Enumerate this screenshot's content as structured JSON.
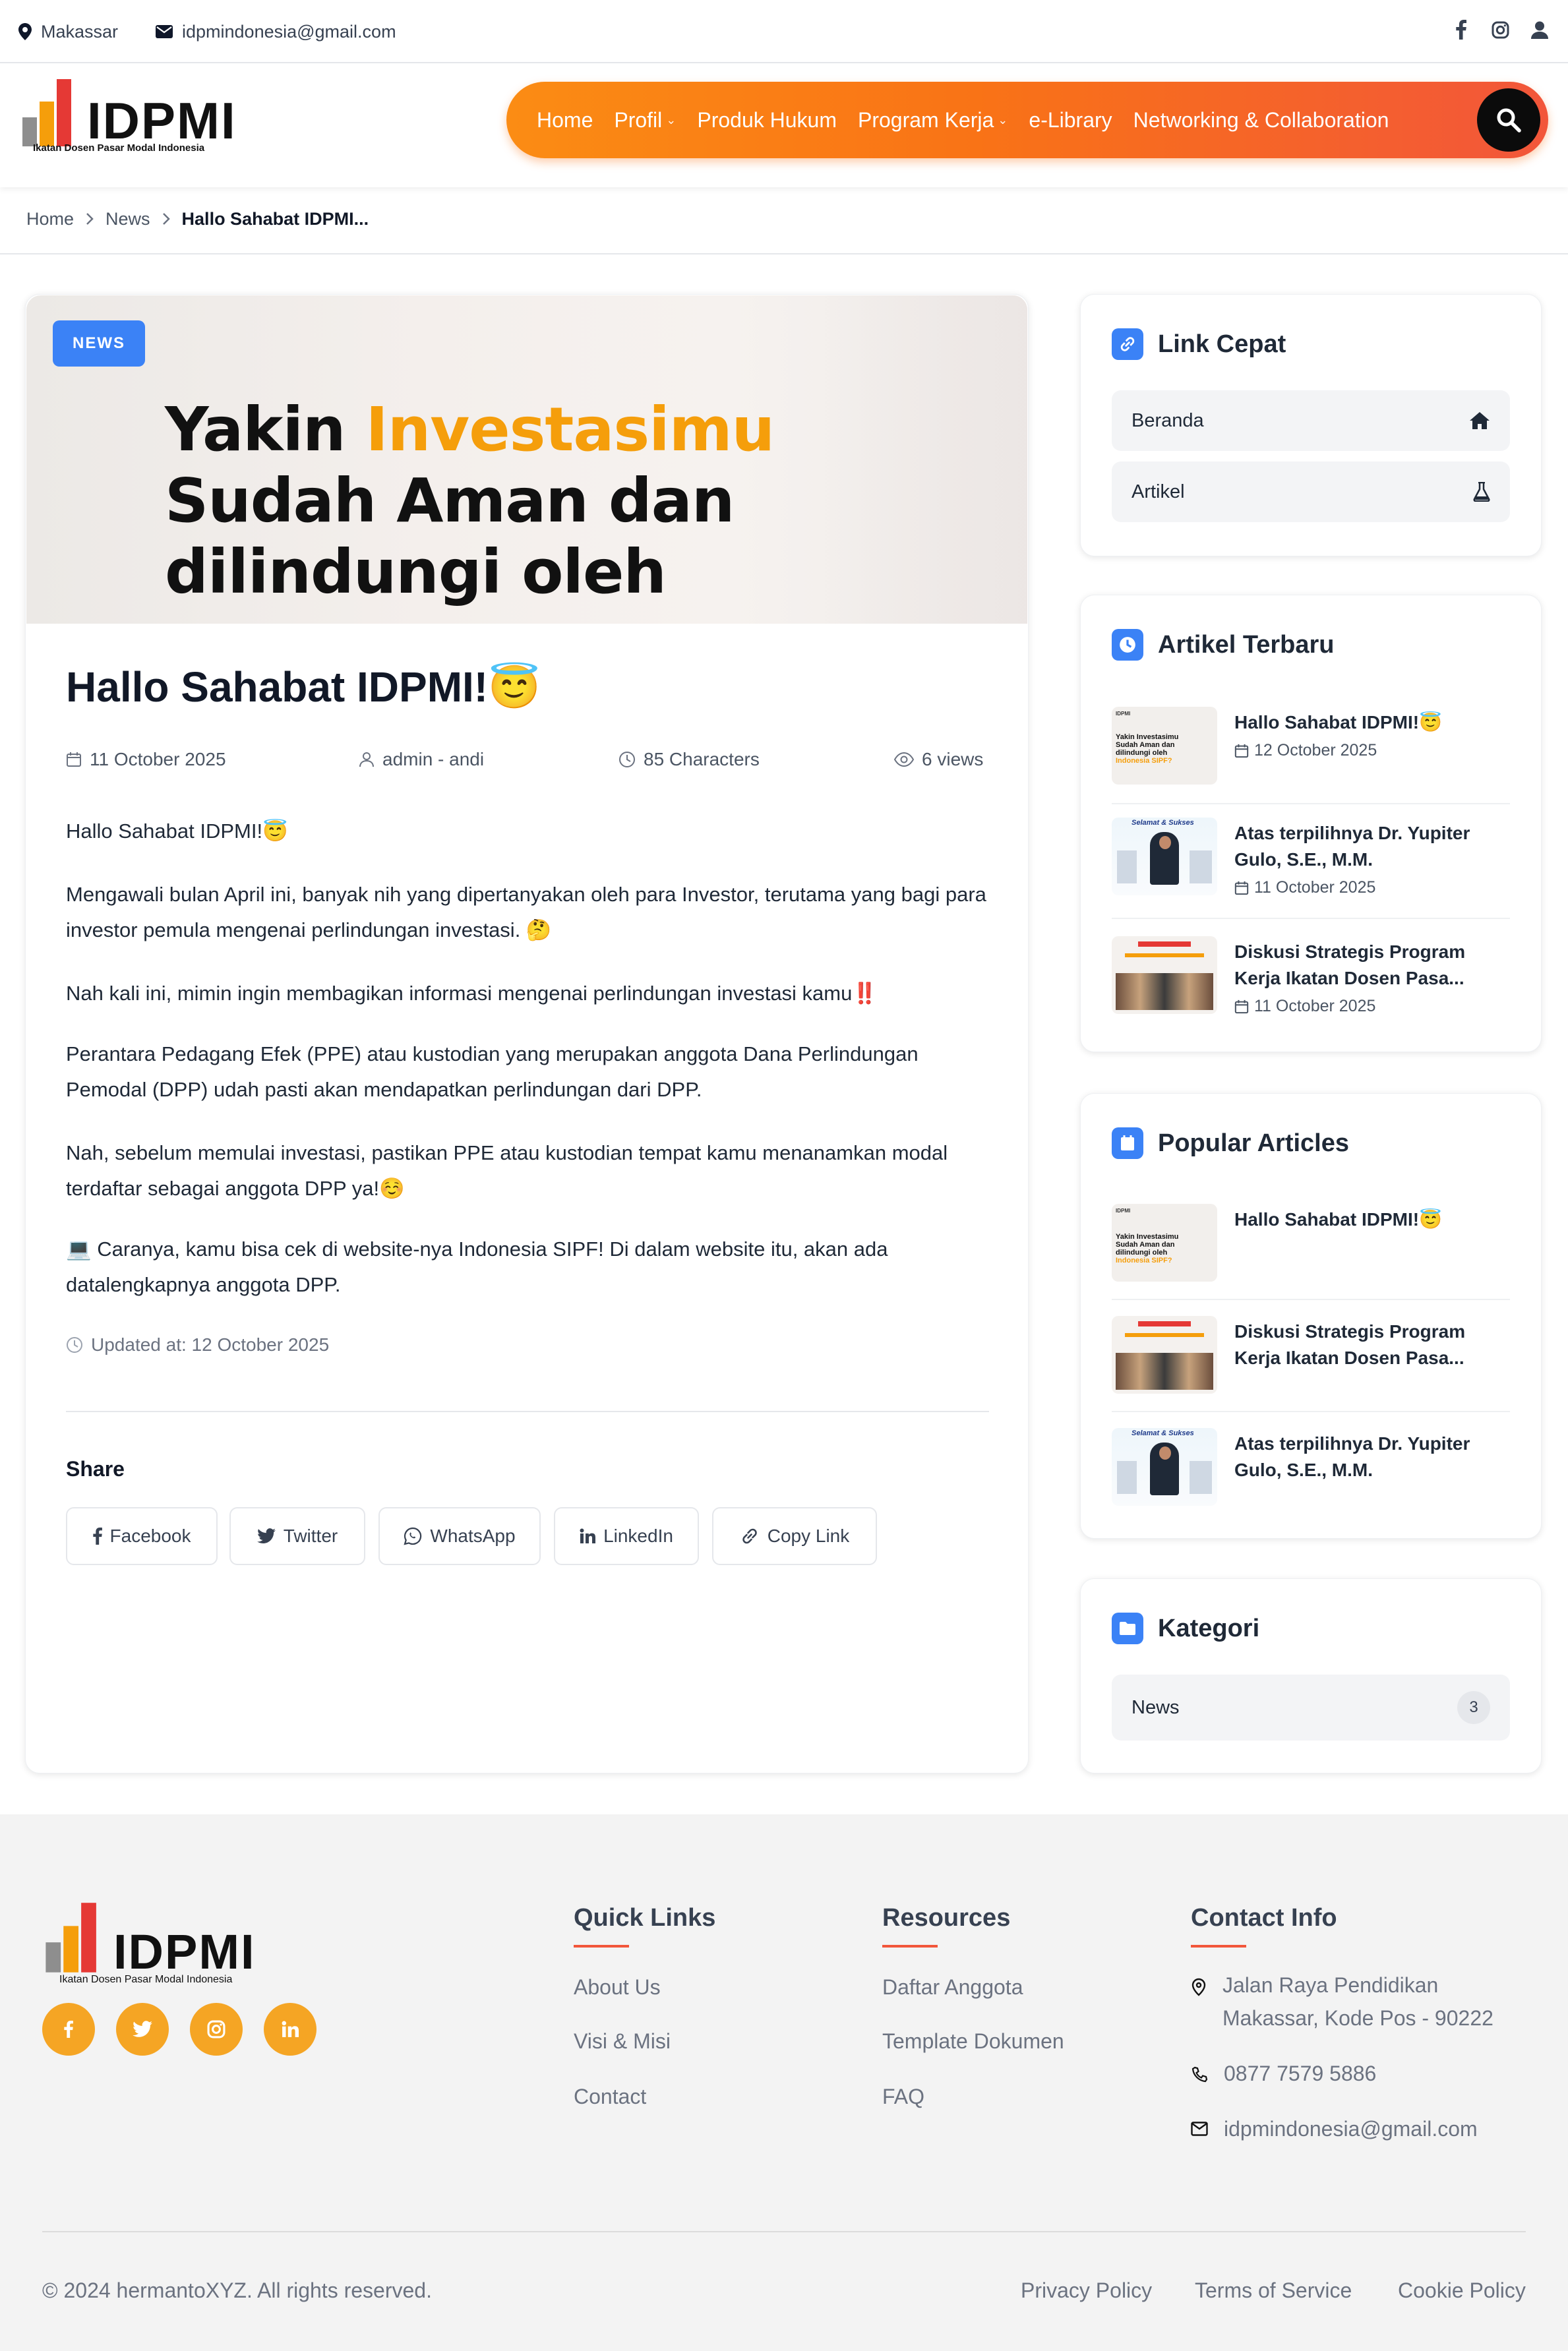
{
  "topbar": {
    "location": "Makassar",
    "email": "idpmindonesia@gmail.com",
    "icons": [
      "facebook-icon",
      "instagram-icon",
      "user-icon"
    ]
  },
  "header": {
    "logo_text": "IDPMI",
    "logo_subtitle": "Ikatan Dosen Pasar Modal Indonesia",
    "nav": [
      {
        "label": "Home",
        "has_dropdown": false
      },
      {
        "label": "Profil",
        "has_dropdown": true
      },
      {
        "label": "Produk Hukum",
        "has_dropdown": false
      },
      {
        "label": "Program Kerja",
        "has_dropdown": true
      },
      {
        "label": "e-Library",
        "has_dropdown": false
      },
      {
        "label": "Networking & Collaboration",
        "has_dropdown": false
      }
    ],
    "search_icon": "search-icon",
    "colors": {
      "nav_start": "#fb8c14",
      "nav_end": "#f2563a",
      "search_bg": "#0b0b0b"
    }
  },
  "breadcrumb": {
    "items": [
      "Home",
      "News"
    ],
    "current": "Hallo Sahabat IDPMI..."
  },
  "article": {
    "badge": "NEWS",
    "hero": {
      "line1_a": "Yakin ",
      "line1_b": "Investasimu",
      "line2": "Sudah Aman dan",
      "line3": "dilindungi oleh"
    },
    "title": "Hallo Sahabat IDPMI!😇",
    "meta": {
      "date": "11 October 2025",
      "author": "admin - andi",
      "length": "85 Characters",
      "views": "6 views"
    },
    "paragraphs": [
      "Hallo Sahabat IDPMI!😇",
      "Mengawali bulan April ini, banyak nih yang dipertanyakan oleh para Investor, terutama yang bagi para investor pemula mengenai perlindungan investasi. 🤔",
      "Nah kali ini, mimin ingin membagikan informasi mengenai perlindungan investasi kamu‼️",
      "Perantara Pedagang Efek (PPE) atau kustodian yang merupakan anggota Dana Perlindungan Pemodal (DPP) udah pasti akan mendapatkan perlindungan dari DPP.",
      "Nah, sebelum memulai investasi, pastikan PPE atau kustodian tempat kamu menanamkan modal terdaftar sebagai anggota DPP ya!☺️",
      "💻 Caranya, kamu bisa cek di website-nya Indonesia SIPF! Di dalam website itu, akan ada datalengkapnya anggota DPP."
    ],
    "updated": "Updated at: 12 October 2025",
    "share_title": "Share",
    "share_buttons": [
      {
        "label": "Facebook",
        "icon": "facebook-icon"
      },
      {
        "label": "Twitter",
        "icon": "twitter-icon"
      },
      {
        "label": "WhatsApp",
        "icon": "whatsapp-icon"
      },
      {
        "label": "LinkedIn",
        "icon": "linkedin-icon"
      },
      {
        "label": "Copy Link",
        "icon": "link-icon"
      }
    ]
  },
  "sidebar": {
    "quick_links": {
      "title": "Link Cepat",
      "items": [
        {
          "label": "Beranda",
          "icon": "home-icon"
        },
        {
          "label": "Artikel",
          "icon": "flask-icon"
        }
      ]
    },
    "latest": {
      "title": "Artikel Terbaru",
      "items": [
        {
          "title": "Hallo Sahabat IDPMI!😇",
          "date": "12 October 2025"
        },
        {
          "title": "Atas terpilihnya Dr. Yupiter Gulo, S.E., M.M.",
          "date": "11 October 2025"
        },
        {
          "title": "Diskusi Strategis Program Kerja Ikatan Dosen Pasa...",
          "date": "11 October 2025"
        }
      ]
    },
    "popular": {
      "title": "Popular Articles",
      "items": [
        {
          "title": "Hallo Sahabat IDPMI!😇"
        },
        {
          "title": "Diskusi Strategis Program Kerja Ikatan Dosen Pasa..."
        },
        {
          "title": "Atas terpilihnya Dr. Yupiter Gulo, S.E., M.M."
        }
      ]
    },
    "categories": {
      "title": "Kategori",
      "items": [
        {
          "label": "News",
          "count": "3"
        }
      ]
    },
    "thumb_texts": {
      "selamat": "Selamat & Sukses",
      "doc_line1": "Yakin Investasimu",
      "doc_line2": "Sudah Aman dan",
      "doc_line3": "dilindungi oleh",
      "doc_line4": "Indonesia SIPF?"
    }
  },
  "footer": {
    "logo_text": "IDPMI",
    "logo_subtitle": "Ikatan Dosen Pasar Modal Indonesia",
    "social": [
      "facebook-icon",
      "twitter-icon",
      "instagram-icon",
      "linkedin-icon"
    ],
    "quick_links": {
      "title": "Quick Links",
      "items": [
        "About Us",
        "Visi & Misi",
        "Contact"
      ]
    },
    "resources": {
      "title": "Resources",
      "items": [
        "Daftar Anggota",
        "Template Dokumen",
        "FAQ"
      ]
    },
    "contact": {
      "title": "Contact Info",
      "address_line1": "Jalan Raya Pendidikan",
      "address_line2": "Makassar, Kode Pos - 90222",
      "phone": "0877 7579 5886",
      "email": "idpmindonesia@gmail.com"
    },
    "copyright": "© 2024 hermantoXYZ. All rights reserved.",
    "legal": [
      "Privacy Policy",
      "Terms of Service",
      "Cookie Policy"
    ]
  }
}
